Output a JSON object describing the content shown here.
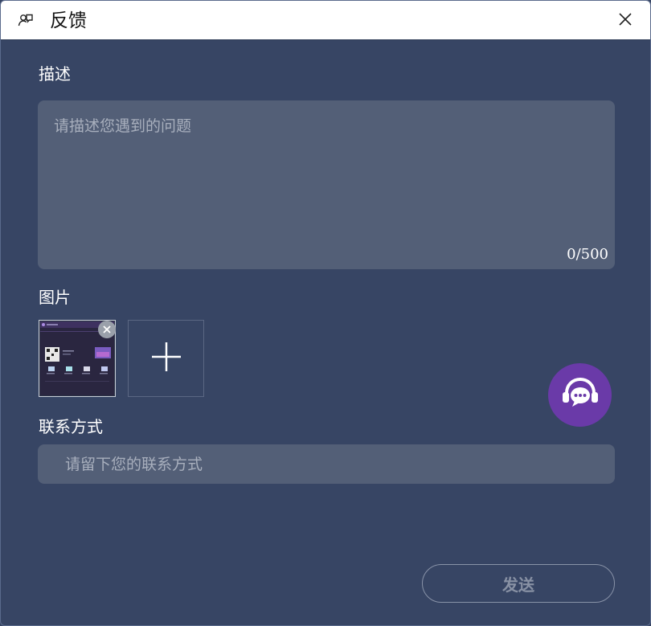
{
  "window": {
    "title": "反馈",
    "title_icon": "feedback-icon",
    "close_icon": "close-icon"
  },
  "description": {
    "label": "描述",
    "placeholder": "请描述您遇到的问题",
    "value": "",
    "counter": "0/500"
  },
  "images": {
    "label": "图片",
    "attached_count": 1,
    "remove_icon": "close-circle-icon",
    "add_icon": "plus-icon"
  },
  "support": {
    "icon": "customer-service-chat-icon",
    "color": "#6a3aa8"
  },
  "contact": {
    "label": "联系方式",
    "placeholder": "请留下您的联系方式",
    "value": ""
  },
  "actions": {
    "send_label": "发送"
  },
  "colors": {
    "background": "#374564",
    "field": "#535f77",
    "titlebar": "#ffffff"
  }
}
